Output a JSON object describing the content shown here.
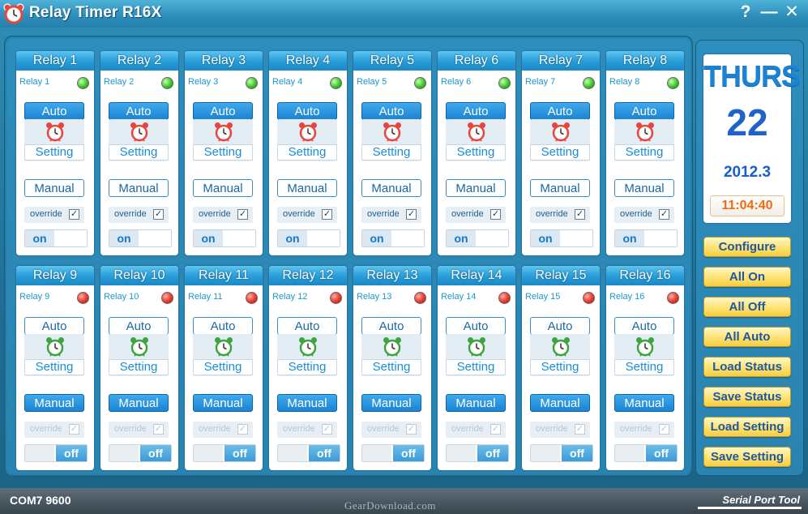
{
  "window": {
    "title": "Relay Timer R16X",
    "help_label": "?",
    "minimize_label": "—",
    "close_label": "✕"
  },
  "relays_top": [
    {
      "title": "Relay 1",
      "label": "Relay 1",
      "status": "green",
      "mode": "auto",
      "override_label": "override",
      "override_checked": "✓",
      "switch": "on"
    },
    {
      "title": "Relay 2",
      "label": "Relay 2",
      "status": "green",
      "mode": "auto",
      "override_label": "override",
      "override_checked": "✓",
      "switch": "on"
    },
    {
      "title": "Relay 3",
      "label": "Relay 3",
      "status": "green",
      "mode": "auto",
      "override_label": "override",
      "override_checked": "✓",
      "switch": "on"
    },
    {
      "title": "Relay 4",
      "label": "Relay 4",
      "status": "green",
      "mode": "auto",
      "override_label": "override",
      "override_checked": "✓",
      "switch": "on"
    },
    {
      "title": "Relay 5",
      "label": "Relay 5",
      "status": "green",
      "mode": "auto",
      "override_label": "override",
      "override_checked": "✓",
      "switch": "on"
    },
    {
      "title": "Relay 6",
      "label": "Relay 6",
      "status": "green",
      "mode": "auto",
      "override_label": "override",
      "override_checked": "✓",
      "switch": "on"
    },
    {
      "title": "Relay 7",
      "label": "Relay 7",
      "status": "green",
      "mode": "auto",
      "override_label": "override",
      "override_checked": "✓",
      "switch": "on"
    },
    {
      "title": "Relay 8",
      "label": "Relay 8",
      "status": "green",
      "mode": "auto",
      "override_label": "override",
      "override_checked": "✓",
      "switch": "on"
    }
  ],
  "relays_bottom": [
    {
      "title": "Relay 9",
      "label": "Relay 9",
      "status": "red",
      "mode": "manual",
      "override_label": "override",
      "override_checked": "✓",
      "switch": "off"
    },
    {
      "title": "Relay 10",
      "label": "Relay 10",
      "status": "red",
      "mode": "manual",
      "override_label": "override",
      "override_checked": "✓",
      "switch": "off"
    },
    {
      "title": "Relay 11",
      "label": "Relay 11",
      "status": "red",
      "mode": "manual",
      "override_label": "override",
      "override_checked": "✓",
      "switch": "off"
    },
    {
      "title": "Relay 12",
      "label": "Relay 12",
      "status": "red",
      "mode": "manual",
      "override_label": "override",
      "override_checked": "✓",
      "switch": "off"
    },
    {
      "title": "Relay 13",
      "label": "Relay 13",
      "status": "red",
      "mode": "manual",
      "override_label": "override",
      "override_checked": "✓",
      "switch": "off"
    },
    {
      "title": "Relay 14",
      "label": "Relay 14",
      "status": "red",
      "mode": "manual",
      "override_label": "override",
      "override_checked": "✓",
      "switch": "off"
    },
    {
      "title": "Relay 15",
      "label": "Relay 15",
      "status": "red",
      "mode": "manual",
      "override_label": "override",
      "override_checked": "✓",
      "switch": "off"
    },
    {
      "title": "Relay 16",
      "label": "Relay 16",
      "status": "red",
      "mode": "manual",
      "override_label": "override",
      "override_checked": "✓",
      "switch": "off"
    }
  ],
  "labels": {
    "auto": "Auto",
    "setting": "Setting",
    "manual": "Manual",
    "on": "on",
    "off": "off"
  },
  "date": {
    "day_name": "THURS",
    "day": "22",
    "year_month": "2012.3",
    "time": "11:04:40"
  },
  "side_buttons": {
    "configure": "Configure",
    "all_on": "All On",
    "all_off": "All Off",
    "all_auto": "All Auto",
    "load_status": "Load Status",
    "save_status": "Save Status",
    "load_setting": "Load Setting",
    "save_setting": "Save Setting"
  },
  "status": {
    "port": "COM7 9600",
    "watermark": "GearDownload.com",
    "brand": "Serial Port Tool"
  },
  "colors": {
    "led_green": "#3fc329",
    "led_red": "#e9372d",
    "clock_red": "#e8463c",
    "clock_green": "#3aa63a",
    "accent_blue": "#1c84d3",
    "button_gold": "#ffe680"
  }
}
